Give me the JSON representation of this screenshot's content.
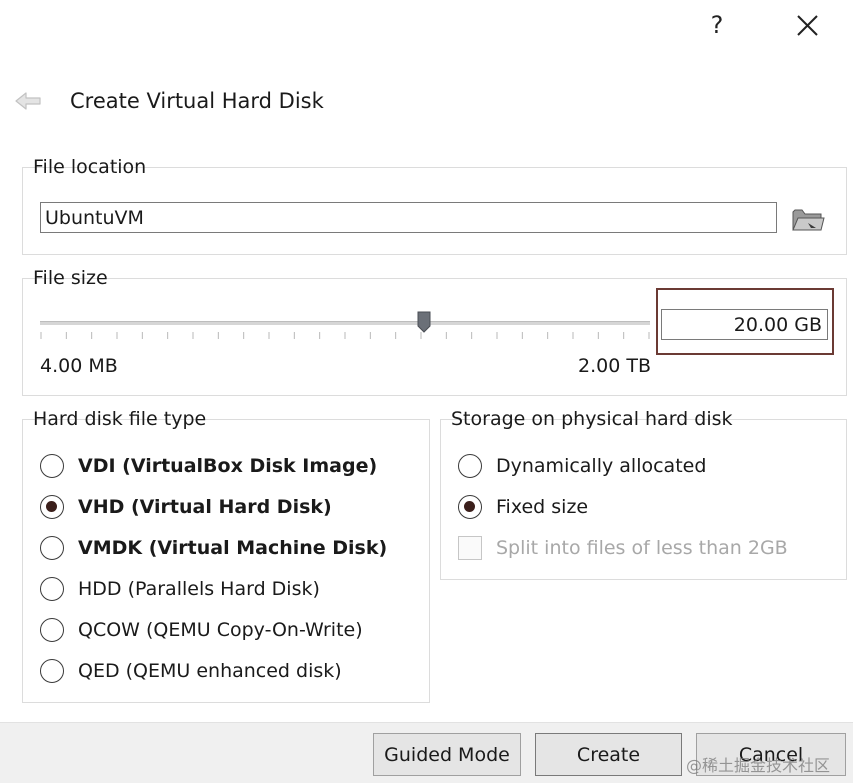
{
  "window": {
    "help_label": "?",
    "title": "Create Virtual Hard Disk"
  },
  "file_location": {
    "title": "File location",
    "value": "UbuntuVM"
  },
  "file_size": {
    "title": "File size",
    "value": "20.00 GB",
    "min_label": "4.00 MB",
    "max_label": "2.00 TB",
    "slider_fraction": 0.63,
    "tick_count": 25
  },
  "hard_disk_type": {
    "title": "Hard disk file type",
    "options": [
      {
        "label": "VDI (VirtualBox Disk Image)",
        "bold": true,
        "checked": false
      },
      {
        "label": "VHD (Virtual Hard Disk)",
        "bold": true,
        "checked": true
      },
      {
        "label": "VMDK (Virtual Machine Disk)",
        "bold": true,
        "checked": false
      },
      {
        "label": "HDD (Parallels Hard Disk)",
        "bold": false,
        "checked": false
      },
      {
        "label": "QCOW (QEMU Copy-On-Write)",
        "bold": false,
        "checked": false
      },
      {
        "label": "QED (QEMU enhanced disk)",
        "bold": false,
        "checked": false
      }
    ]
  },
  "storage": {
    "title": "Storage on physical hard disk",
    "options": [
      {
        "label": "Dynamically allocated",
        "checked": false
      },
      {
        "label": "Fixed size",
        "checked": true
      }
    ],
    "split_label": "Split into files of less than 2GB",
    "split_enabled": false
  },
  "buttons": {
    "guided": "Guided Mode",
    "create": "Create",
    "cancel": "Cancel"
  },
  "watermark": "@稀土掘金技术社区",
  "colors": {
    "accent_frame": "#6b3a34",
    "radio_dot": "#3b1f1b"
  }
}
